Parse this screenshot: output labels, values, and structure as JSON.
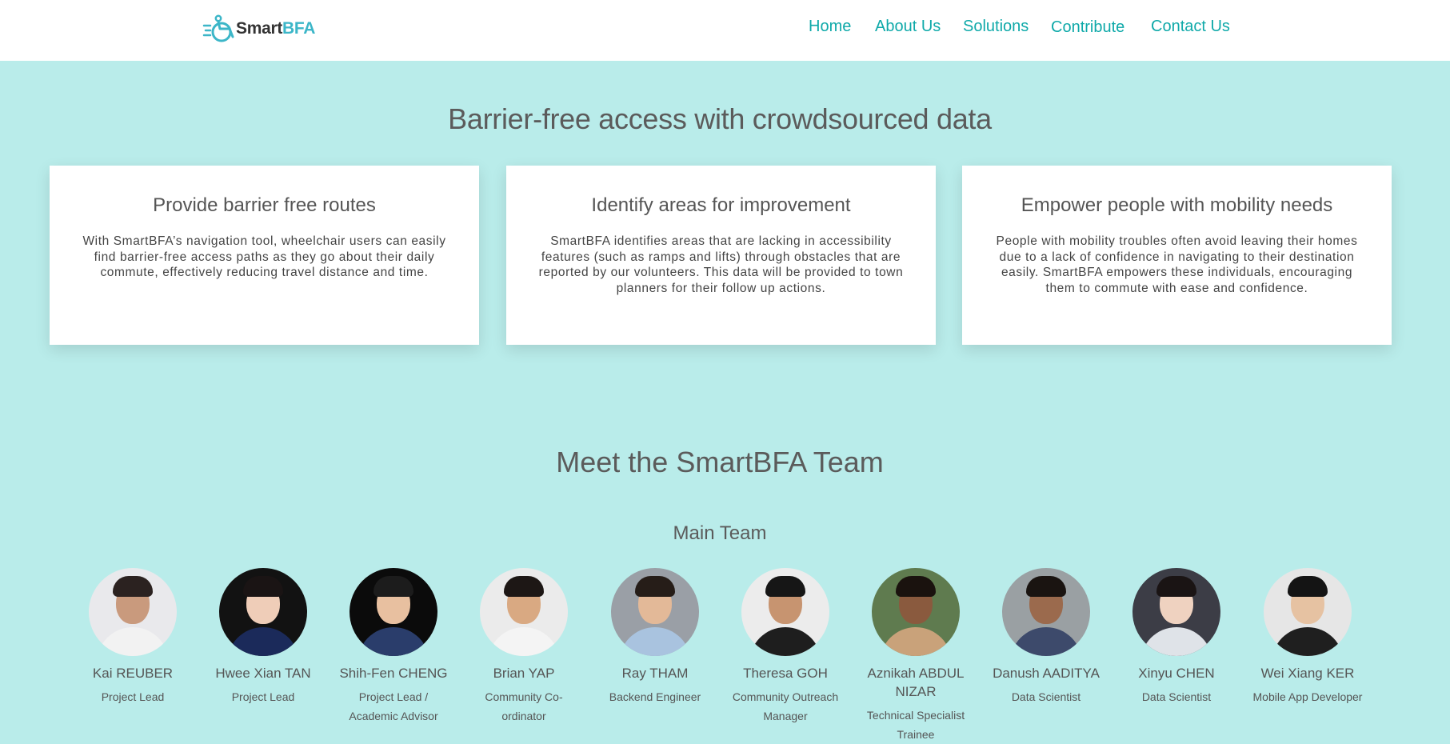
{
  "brand": {
    "name_part1": "Smart",
    "name_part2": "BFA",
    "accent_color": "#3cb6c8"
  },
  "nav": {
    "items": [
      {
        "label": "Home"
      },
      {
        "label": "About Us"
      },
      {
        "label": "Solutions"
      },
      {
        "label": "Contribute"
      },
      {
        "label": "Contact Us"
      }
    ]
  },
  "hero": {
    "title": "Barrier-free access with crowdsourced data"
  },
  "features": [
    {
      "title": "Provide barrier free routes",
      "text": "With SmartBFA’s navigation tool, wheelchair users can easily find barrier-free access paths as they go about their daily commute, effectively reducing travel distance and time."
    },
    {
      "title": "Identify areas for improvement",
      "text": "SmartBFA identifies areas that are lacking in accessibility features (such as ramps and lifts) through obstacles that are reported by our volunteers. This data will be provided to town planners for their follow up actions."
    },
    {
      "title": "Empower people with mobility needs",
      "text": "People with mobility troubles often avoid leaving their homes due to a lack of confidence in navigating to their destination easily. SmartBFA empowers these individuals, encouraging them to commute with ease and confidence."
    }
  ],
  "team": {
    "title": "Meet the SmartBFA Team",
    "main_team_label": "Main Team",
    "members": [
      {
        "name": "Kai REUBER",
        "role": "Project Lead",
        "bg": "#e9e9ec",
        "skin": "#c99a7d",
        "hair": "#2b2220",
        "shirt": "#f2f2f2"
      },
      {
        "name": "Hwee Xian TAN",
        "role": "Project Lead",
        "bg": "#121212",
        "skin": "#efcdb8",
        "hair": "#1a1414",
        "shirt": "#1b2a5a"
      },
      {
        "name": "Shih-Fen CHENG",
        "role": "Project Lead / Academic Advisor",
        "bg": "#0b0b0b",
        "skin": "#e8c0a0",
        "hair": "#1c1c1c",
        "shirt": "#2a3d6b"
      },
      {
        "name": "Brian YAP",
        "role": "Community Co-ordinator",
        "bg": "#ebebeb",
        "skin": "#d9a982",
        "hair": "#1d1715",
        "shirt": "#f4f4f4"
      },
      {
        "name": "Ray THAM",
        "role": "Backend Engineer",
        "bg": "#9a9fa6",
        "skin": "#e3b998",
        "hair": "#261d18",
        "shirt": "#a9c3df"
      },
      {
        "name": "Theresa GOH",
        "role": "Community Outreach Manager",
        "bg": "#ececec",
        "skin": "#c79470",
        "hair": "#161616",
        "shirt": "#1e1e1e"
      },
      {
        "name": "Aznikah ABDUL NIZAR",
        "role": "Technical Specialist Trainee",
        "bg": "#5f7b4f",
        "skin": "#8a5a3e",
        "hair": "#1a120e",
        "shirt": "#c9a27a"
      },
      {
        "name": "Danush AADITYA",
        "role": "Data Scientist",
        "bg": "#9aa0a3",
        "skin": "#9b6a4d",
        "hair": "#1a1411",
        "shirt": "#3d4a6b"
      },
      {
        "name": "Xinyu CHEN",
        "role": "Data Scientist",
        "bg": "#3c3d46",
        "skin": "#efd2c0",
        "hair": "#1a1414",
        "shirt": "#dfe3e8"
      },
      {
        "name": "Wei Xiang KER",
        "role": "Mobile App Developer",
        "bg": "#e6e6e6",
        "skin": "#e6c2a2",
        "hair": "#141414",
        "shirt": "#1f1f1f"
      }
    ]
  }
}
